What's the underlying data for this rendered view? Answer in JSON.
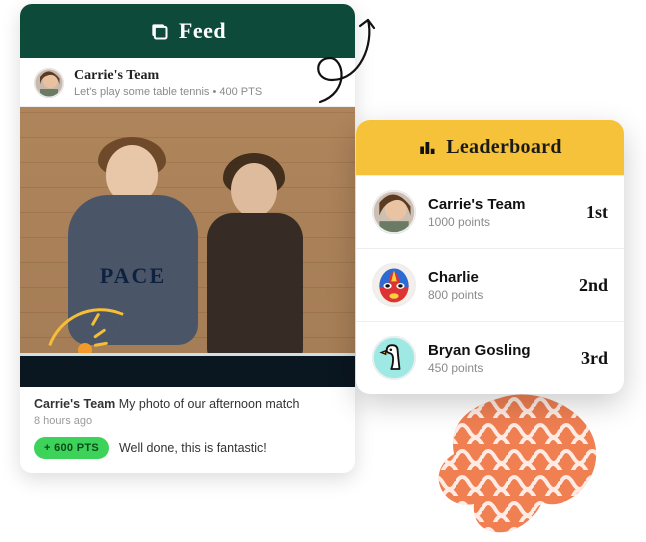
{
  "feed": {
    "title": "Feed",
    "post": {
      "team_name": "Carrie's Team",
      "subline": "Let's play some table tennis • 400 PTS",
      "jersey_text": "PACE",
      "caption_author": "Carrie's Team",
      "caption_text": "My photo of our afternoon match",
      "time_ago": "8 hours ago",
      "badge_text": "+ 600 PTS",
      "comment_text": "Well done, this is fantastic!"
    }
  },
  "leaderboard": {
    "title": "Leaderboard",
    "rows": [
      {
        "name": "Carrie's Team",
        "points": "1000 points",
        "rank": "1st"
      },
      {
        "name": "Charlie",
        "points": "800 points",
        "rank": "2nd"
      },
      {
        "name": "Bryan Gosling",
        "points": "450 points",
        "rank": "3rd"
      }
    ]
  }
}
